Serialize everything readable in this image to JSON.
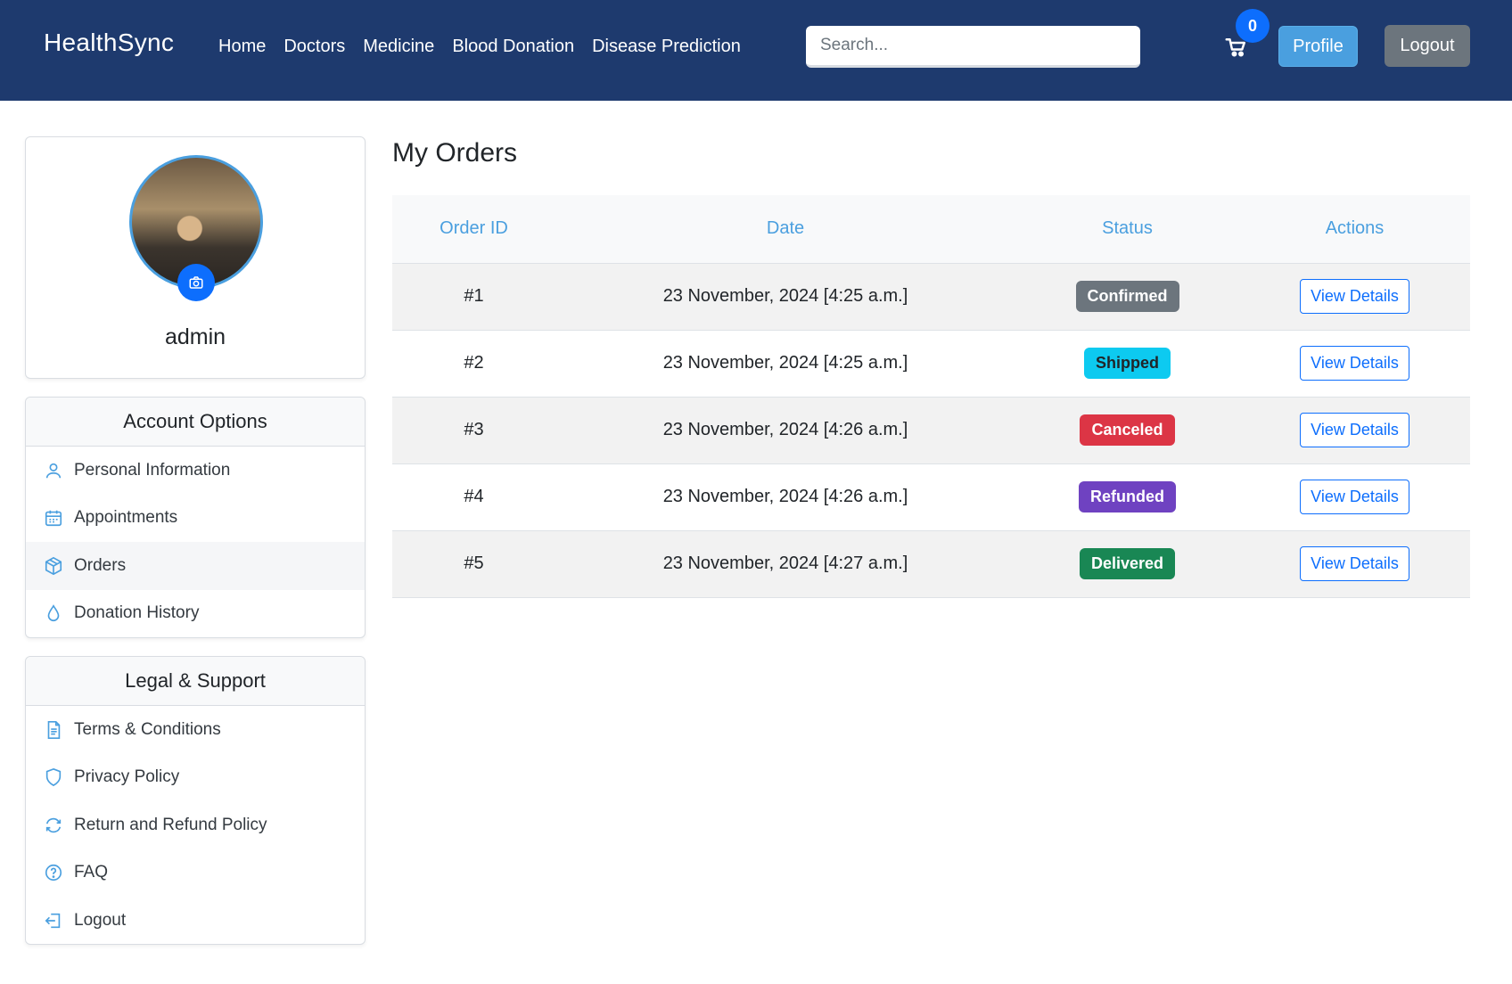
{
  "navbar": {
    "brand": "HealthSync",
    "links": [
      "Home",
      "Doctors",
      "Medicine",
      "Blood Donation",
      "Disease Prediction"
    ],
    "search_placeholder": "Search...",
    "cart_count": "0",
    "profile_label": "Profile",
    "logout_label": "Logout"
  },
  "profile": {
    "username": "admin"
  },
  "account_options": {
    "title": "Account Options",
    "items": [
      {
        "label": "Personal Information",
        "icon": "person-icon"
      },
      {
        "label": "Appointments",
        "icon": "calendar-icon"
      },
      {
        "label": "Orders",
        "icon": "box-icon"
      },
      {
        "label": "Donation History",
        "icon": "droplet-icon"
      }
    ]
  },
  "legal_support": {
    "title": "Legal & Support",
    "items": [
      {
        "label": "Terms & Conditions",
        "icon": "document-icon"
      },
      {
        "label": "Privacy Policy",
        "icon": "shield-icon"
      },
      {
        "label": "Return and Refund Policy",
        "icon": "refresh-icon"
      },
      {
        "label": "FAQ",
        "icon": "question-icon"
      },
      {
        "label": "Logout",
        "icon": "logout-icon"
      }
    ]
  },
  "orders": {
    "title": "My Orders",
    "columns": [
      "Order ID",
      "Date",
      "Status",
      "Actions"
    ],
    "rows": [
      {
        "id": "#1",
        "date": "23 November, 2024 [4:25 a.m.]",
        "status": "Confirmed",
        "status_color": "#6c757d",
        "status_text_color": "#ffffff",
        "action": "View Details"
      },
      {
        "id": "#2",
        "date": "23 November, 2024 [4:25 a.m.]",
        "status": "Shipped",
        "status_color": "#0dcaf0",
        "status_text_color": "#212529",
        "action": "View Details"
      },
      {
        "id": "#3",
        "date": "23 November, 2024 [4:26 a.m.]",
        "status": "Canceled",
        "status_color": "#dc3545",
        "status_text_color": "#ffffff",
        "action": "View Details"
      },
      {
        "id": "#4",
        "date": "23 November, 2024 [4:26 a.m.]",
        "status": "Refunded",
        "status_color": "#6f42c1",
        "status_text_color": "#ffffff",
        "action": "View Details"
      },
      {
        "id": "#5",
        "date": "23 November, 2024 [4:27 a.m.]",
        "status": "Delivered",
        "status_color": "#198754",
        "status_text_color": "#ffffff",
        "action": "View Details"
      }
    ]
  }
}
